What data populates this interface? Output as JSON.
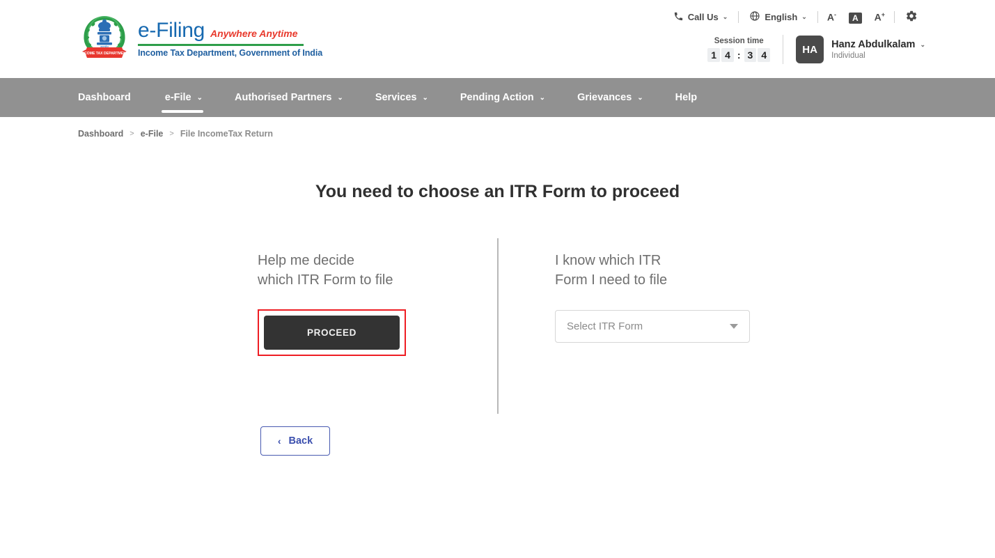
{
  "header": {
    "brand": {
      "emblem_icon": "india-emblem-income-tax-icon",
      "name": "e-Filing",
      "tagline": "Anywhere Anytime",
      "department": "Income Tax Department, Government of India",
      "colors": {
        "name": "#1769b0",
        "tagline": "#e8392c",
        "rule": "#2e9e4a",
        "department": "#1f5fa0"
      }
    },
    "top_links": {
      "call_us": {
        "icon": "phone-icon",
        "label": "Call Us",
        "caret": "⌄"
      },
      "language": {
        "icon": "globe-icon",
        "label": "English",
        "caret": "⌄"
      },
      "font_decrease": {
        "icon": "font-decrease-icon",
        "label": "A",
        "sup": "-"
      },
      "font_normal": {
        "icon": "font-normal-icon",
        "label": "A"
      },
      "font_increase": {
        "icon": "font-increase-icon",
        "label": "A",
        "sup": "+"
      },
      "settings": {
        "icon": "gear-icon"
      }
    },
    "session": {
      "label": "Session time",
      "minutes": [
        "1",
        "4"
      ],
      "separator": ":",
      "seconds": [
        "3",
        "4"
      ],
      "display": "14 : 34"
    },
    "user": {
      "initials": "HA",
      "name": "Hanz Abdulkalam",
      "type": "Individual",
      "caret": "⌄"
    }
  },
  "nav": {
    "background": "#919191",
    "items": [
      {
        "label": "Dashboard",
        "has_caret": false,
        "active": false
      },
      {
        "label": "e-File",
        "has_caret": true,
        "active": true
      },
      {
        "label": "Authorised Partners",
        "has_caret": true,
        "active": false
      },
      {
        "label": "Services",
        "has_caret": true,
        "active": false
      },
      {
        "label": "Pending Action",
        "has_caret": true,
        "active": false
      },
      {
        "label": "Grievances",
        "has_caret": true,
        "active": false
      },
      {
        "label": "Help",
        "has_caret": false,
        "active": false
      }
    ]
  },
  "breadcrumb": {
    "separator": ">",
    "items": [
      "Dashboard",
      "e-File",
      "File IncomeTax Return"
    ]
  },
  "main": {
    "title": "You need to choose an ITR Form to proceed",
    "left_panel": {
      "heading": "Help me decide\nwhich ITR Form to file",
      "proceed_label": "PROCEED",
      "highlight_color": "#ee1d23",
      "button_color": "#333333"
    },
    "right_panel": {
      "heading": "I know which ITR\nForm I need to file",
      "select_placeholder": "Select ITR Form",
      "caret_icon": "chevron-down-icon"
    },
    "back_button": {
      "label": "Back",
      "icon": "chevron-left-icon",
      "glyph": "‹",
      "color": "#3b4fae"
    }
  }
}
